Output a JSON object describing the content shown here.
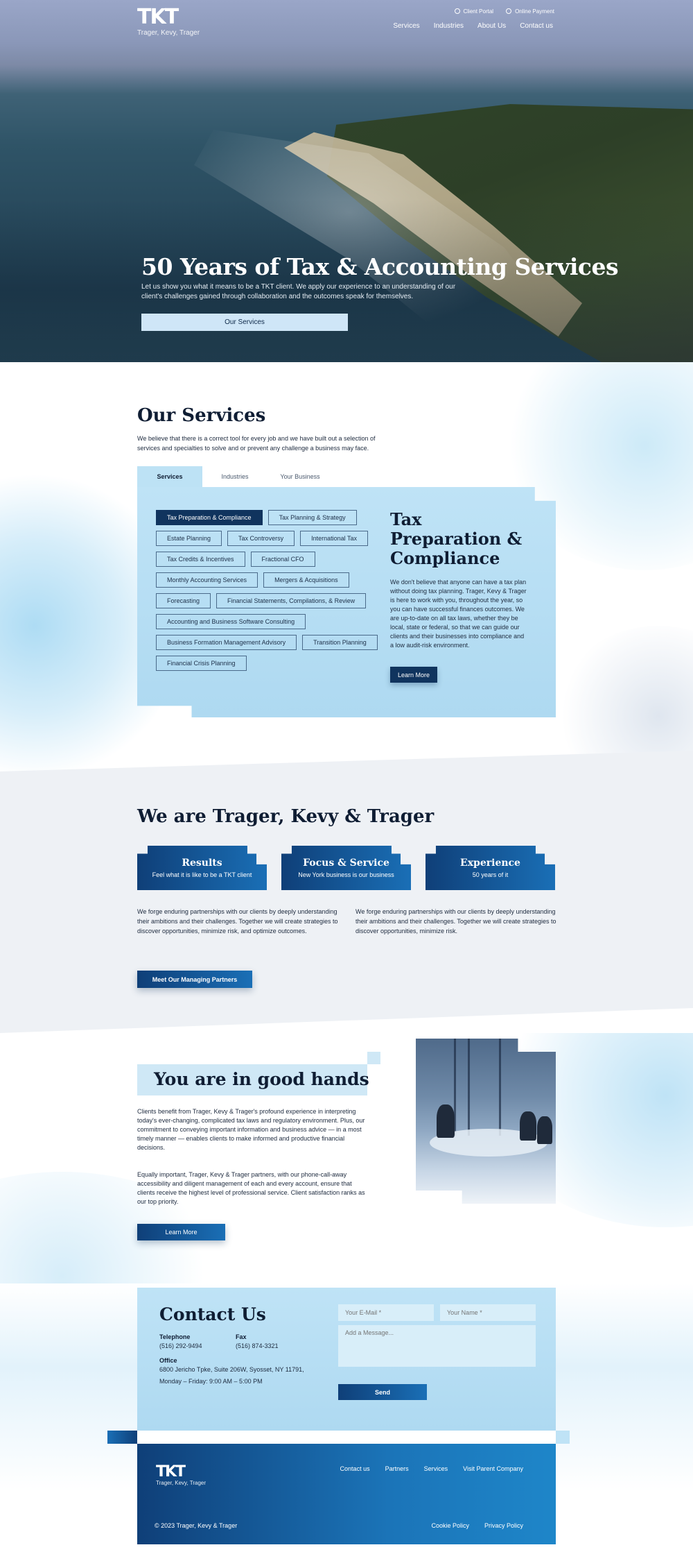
{
  "header": {
    "logo_mark": "TKT",
    "logo_sub": "Trager, Kevy, Trager",
    "utility": [
      "Client Portal",
      "Online Payment"
    ],
    "nav": [
      "Services",
      "Industries",
      "About Us",
      "Contact us"
    ]
  },
  "hero": {
    "title": "50 Years of Tax & Accounting Services",
    "lede": "Let us show you what it means to be a TKT client.  We apply our experience to an understanding of our client's challenges gained through collaboration and the outcomes speak for themselves.",
    "cta": "Our Services"
  },
  "services": {
    "title": "Our Services",
    "intro": "We believe that there is a correct tool for every job and we have built out a selection of services and specialties to solve and or prevent any challenge a business may face.",
    "tabs": [
      "Services",
      "Industries",
      "Your Business"
    ],
    "chips": [
      "Tax Preparation & Compliance",
      "Tax Planning & Strategy",
      "Estate Planning",
      "Tax Controversy",
      "International Tax",
      "Tax Credits & Incentives",
      "Fractional CFO",
      "Monthly Accounting Services",
      "Mergers & Acquisitions",
      "Forecasting",
      "Financial Statements, Compilations, & Review",
      "Accounting and Business Software Consulting",
      "Business Formation Management Advisory",
      "Transition Planning",
      "Financial Crisis Planning"
    ],
    "detail_title": "Tax Preparation & Compliance",
    "detail_text": "We don't believe that anyone can have a tax plan without doing tax planning.  Trager, Kevy & Trager is here to work with you, throughout the year, so you can have successful finances outcomes. We are up-to-date on all tax laws, whether they be local, state or federal, so that we can guide our clients and their businesses into compliance and a low audit-risk environment.",
    "detail_button": "Learn More"
  },
  "about": {
    "title": "We are Trager, Kevy & Trager",
    "cards": [
      {
        "title": "Results",
        "sub": "Feel what it is like to be a TKT client"
      },
      {
        "title": "Focus & Service",
        "sub": "New York business is our business"
      },
      {
        "title": "Experience",
        "sub": "50 years of it"
      }
    ],
    "col1": "We forge enduring partnerships with our clients by deeply understanding their ambitions and their challenges. Together we will create strategies to discover opportunities, minimize risk, and optimize outcomes.",
    "col2": "We forge enduring partnerships with our clients by deeply understanding their ambitions and their challenges. Together we will create strategies to discover opportunities, minimize risk.",
    "button": "Meet Our Managing Partners"
  },
  "hands": {
    "title": "You are in good hands",
    "p1": "Clients benefit from Trager, Kevy & Trager's profound experience in interpreting today's ever-changing, complicated tax laws and regulatory environment. Plus, our commitment to conveying important information and business advice — in a most timely manner — enables clients to make informed and productive financial decisions.",
    "p2": "Equally important, Trager, Kevy & Trager partners, with our phone-call-away accessibility and diligent management of each and every account, ensure that clients receive the highest level of professional service. Client satisfaction ranks as our top priority.",
    "button": "Learn More"
  },
  "contact": {
    "title": "Contact Us",
    "telephone_label": "Telephone",
    "telephone": "(516) 292-9494",
    "fax_label": "Fax",
    "fax": "(516) 874-3321",
    "office_label": "Office",
    "address": "6800 Jericho Tpke, Suite 206W, Syosset, NY 11791,",
    "hours": "Monday – Friday: 9:00 AM – 5:00 PM",
    "email_placeholder": "Your E-Mail *",
    "name_placeholder": "Your Name *",
    "message_placeholder": "Add a Message...",
    "send": "Send"
  },
  "footer": {
    "logo_mark": "TKT",
    "logo_sub": "Trager, Kevy, Trager",
    "nav": [
      "Contact us",
      "Partners",
      "Services",
      "Visit Parent Company"
    ],
    "copyright": "© 2023 Trager, Kevy & Trager",
    "legal": [
      "Cookie Policy",
      "Privacy Policy"
    ]
  }
}
